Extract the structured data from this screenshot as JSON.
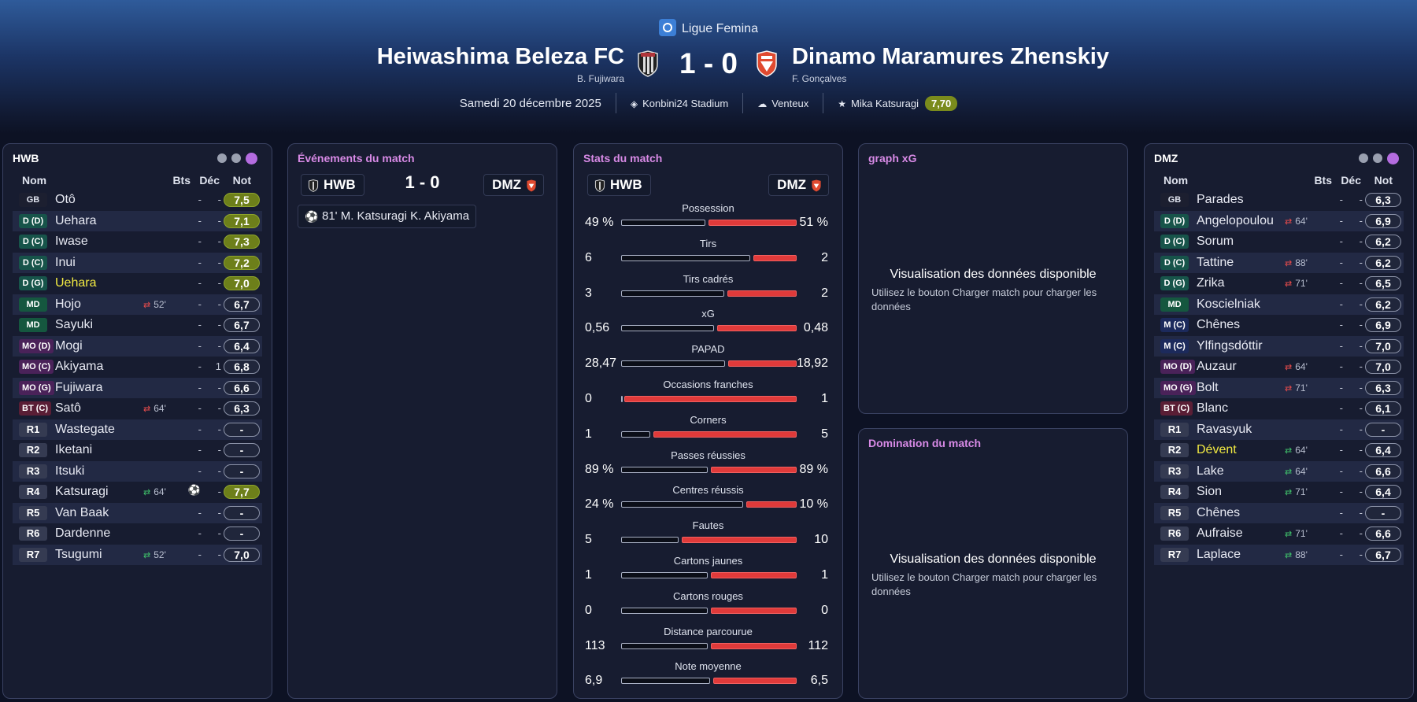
{
  "header": {
    "league": "Ligue Femina",
    "home": {
      "name": "Heiwashima Beleza FC",
      "coach": "B. Fujiwara"
    },
    "away": {
      "name": "Dinamo Maramures Zhenskiy",
      "coach": "F. Gonçalves"
    },
    "score": "1 - 0",
    "date": "Samedi 20 décembre 2025",
    "stadium": "Konbini24 Stadium",
    "weather": "Venteux",
    "motm_name": "Mika Katsuragi",
    "motm_rating": "7,70"
  },
  "lineup_headers": {
    "name": "Nom",
    "goals": "Bts",
    "dec": "Déc",
    "rating": "Not"
  },
  "home_lineup": {
    "title": "HWB",
    "players": [
      {
        "pos": "GB",
        "cls": "gk",
        "name": "Otô",
        "sub": "",
        "subdir": "",
        "bts": "-",
        "dec": "-",
        "rating": "7,5",
        "green": true
      },
      {
        "pos": "D (D)",
        "cls": "def",
        "name": "Uehara",
        "sub": "",
        "subdir": "",
        "bts": "-",
        "dec": "-",
        "rating": "7,1",
        "green": true
      },
      {
        "pos": "D (C)",
        "cls": "def",
        "name": "Iwase",
        "sub": "",
        "subdir": "",
        "bts": "-",
        "dec": "-",
        "rating": "7,3",
        "green": true
      },
      {
        "pos": "D (C)",
        "cls": "def",
        "name": "Inui",
        "sub": "",
        "subdir": "",
        "bts": "-",
        "dec": "-",
        "rating": "7,2",
        "green": true
      },
      {
        "pos": "D (G)",
        "cls": "def",
        "name": "Uehara",
        "hl": true,
        "sub": "",
        "subdir": "",
        "bts": "-",
        "dec": "-",
        "rating": "7,0",
        "green": true
      },
      {
        "pos": "MD",
        "cls": "mid",
        "name": "Hojo",
        "sub": "52'",
        "subdir": "out",
        "bts": "-",
        "dec": "-",
        "rating": "6,7"
      },
      {
        "pos": "MD",
        "cls": "mid",
        "name": "Sayuki",
        "sub": "",
        "subdir": "",
        "bts": "-",
        "dec": "-",
        "rating": "6,7"
      },
      {
        "pos": "MO (D)",
        "cls": "mo",
        "name": "Mogi",
        "sub": "",
        "subdir": "",
        "bts": "-",
        "dec": "-",
        "rating": "6,4"
      },
      {
        "pos": "MO (C)",
        "cls": "mo",
        "name": "Akiyama",
        "sub": "",
        "subdir": "",
        "bts": "-",
        "dec": "1",
        "rating": "6,8"
      },
      {
        "pos": "MO (G)",
        "cls": "mo",
        "name": "Fujiwara",
        "sub": "",
        "subdir": "",
        "bts": "-",
        "dec": "-",
        "rating": "6,6"
      },
      {
        "pos": "BT (C)",
        "cls": "bt",
        "name": "Satô",
        "sub": "64'",
        "subdir": "out",
        "bts": "-",
        "dec": "-",
        "rating": "6,3"
      },
      {
        "pos": "R1",
        "cls": "sub",
        "name": "Wastegate",
        "sub": "",
        "subdir": "",
        "bts": "-",
        "dec": "-",
        "rating": "-"
      },
      {
        "pos": "R2",
        "cls": "sub",
        "name": "Iketani",
        "sub": "",
        "subdir": "",
        "bts": "-",
        "dec": "-",
        "rating": "-"
      },
      {
        "pos": "R3",
        "cls": "sub",
        "name": "Itsuki",
        "sub": "",
        "subdir": "",
        "bts": "-",
        "dec": "-",
        "rating": "-"
      },
      {
        "pos": "R4",
        "cls": "sub",
        "name": "Katsuragi",
        "sub": "64'",
        "subdir": "in",
        "bts": "goal",
        "dec": "-",
        "rating": "7,7",
        "green": true
      },
      {
        "pos": "R5",
        "cls": "sub",
        "name": "Van Baak",
        "sub": "",
        "subdir": "",
        "bts": "-",
        "dec": "-",
        "rating": "-"
      },
      {
        "pos": "R6",
        "cls": "sub",
        "name": "Dardenne",
        "sub": "",
        "subdir": "",
        "bts": "-",
        "dec": "-",
        "rating": "-"
      },
      {
        "pos": "R7",
        "cls": "sub",
        "name": "Tsugumi",
        "sub": "52'",
        "subdir": "in",
        "bts": "-",
        "dec": "-",
        "rating": "7,0"
      }
    ]
  },
  "away_lineup": {
    "title": "DMZ",
    "players": [
      {
        "pos": "GB",
        "cls": "gk",
        "name": "Parades",
        "sub": "",
        "subdir": "",
        "bts": "-",
        "dec": "-",
        "rating": "6,3"
      },
      {
        "pos": "D (D)",
        "cls": "def",
        "name": "Angelopoulou",
        "sub": "64'",
        "subdir": "out",
        "bts": "-",
        "dec": "-",
        "rating": "6,9"
      },
      {
        "pos": "D (C)",
        "cls": "def",
        "name": "Sorum",
        "sub": "",
        "subdir": "",
        "bts": "-",
        "dec": "-",
        "rating": "6,2"
      },
      {
        "pos": "D (C)",
        "cls": "def",
        "name": "Tattine",
        "sub": "88'",
        "subdir": "out",
        "bts": "-",
        "dec": "-",
        "rating": "6,2"
      },
      {
        "pos": "D (G)",
        "cls": "def",
        "name": "Zrika",
        "sub": "71'",
        "subdir": "out",
        "bts": "-",
        "dec": "-",
        "rating": "6,5"
      },
      {
        "pos": "MD",
        "cls": "mid",
        "name": "Koscielniak",
        "sub": "",
        "subdir": "",
        "bts": "-",
        "dec": "-",
        "rating": "6,2"
      },
      {
        "pos": "M (C)",
        "cls": "mc",
        "name": "Chênes",
        "sub": "",
        "subdir": "",
        "bts": "-",
        "dec": "-",
        "rating": "6,9"
      },
      {
        "pos": "M (C)",
        "cls": "mc",
        "name": "Ylfingsdóttir",
        "sub": "",
        "subdir": "",
        "bts": "-",
        "dec": "-",
        "rating": "7,0"
      },
      {
        "pos": "MO (D)",
        "cls": "mo",
        "name": "Auzaur",
        "sub": "64'",
        "subdir": "out",
        "bts": "-",
        "dec": "-",
        "rating": "7,0"
      },
      {
        "pos": "MO (G)",
        "cls": "mo",
        "name": "Bolt",
        "sub": "71'",
        "subdir": "out",
        "bts": "-",
        "dec": "-",
        "rating": "6,3"
      },
      {
        "pos": "BT (C)",
        "cls": "bt",
        "name": "Blanc",
        "sub": "",
        "subdir": "",
        "bts": "-",
        "dec": "-",
        "rating": "6,1"
      },
      {
        "pos": "R1",
        "cls": "sub",
        "name": "Ravasyuk",
        "sub": "",
        "subdir": "",
        "bts": "-",
        "dec": "-",
        "rating": "-"
      },
      {
        "pos": "R2",
        "cls": "sub",
        "name": "Dévent",
        "hl": true,
        "sub": "64'",
        "subdir": "in",
        "bts": "-",
        "dec": "-",
        "rating": "6,4"
      },
      {
        "pos": "R3",
        "cls": "sub",
        "name": "Lake",
        "sub": "64'",
        "subdir": "in",
        "bts": "-",
        "dec": "-",
        "rating": "6,6"
      },
      {
        "pos": "R4",
        "cls": "sub",
        "name": "Sion",
        "sub": "71'",
        "subdir": "in",
        "bts": "-",
        "dec": "-",
        "rating": "6,4"
      },
      {
        "pos": "R5",
        "cls": "sub",
        "name": "Chênes",
        "sub": "",
        "subdir": "",
        "bts": "-",
        "dec": "-",
        "rating": "-"
      },
      {
        "pos": "R6",
        "cls": "sub",
        "name": "Aufraise",
        "sub": "71'",
        "subdir": "in",
        "bts": "-",
        "dec": "-",
        "rating": "6,6"
      },
      {
        "pos": "R7",
        "cls": "sub",
        "name": "Laplace",
        "sub": "88'",
        "subdir": "in",
        "bts": "-",
        "dec": "-",
        "rating": "6,7"
      }
    ]
  },
  "events": {
    "title": "Événements du match",
    "home_short": "HWB",
    "away_short": "DMZ",
    "score": "1 - 0",
    "items": [
      {
        "text": "81' M. Katsuragi K. Akiyama"
      }
    ]
  },
  "stats": {
    "title": "Stats du match",
    "home_short": "HWB",
    "away_short": "DMZ",
    "rows": [
      {
        "label": "Possession",
        "home": "49 %",
        "away": "51 %",
        "hv": 49,
        "av": 51
      },
      {
        "label": "Tirs",
        "home": "6",
        "away": "2",
        "hv": 6,
        "av": 2
      },
      {
        "label": "Tirs cadrés",
        "home": "3",
        "away": "2",
        "hv": 3,
        "av": 2
      },
      {
        "label": "xG",
        "home": "0,56",
        "away": "0,48",
        "hv": 0.56,
        "av": 0.48
      },
      {
        "label": "PAPAD",
        "home": "28,47",
        "away": "18,92",
        "hv": 28.47,
        "av": 18.92
      },
      {
        "label": "Occasions franches",
        "home": "0",
        "away": "1",
        "hv": 0,
        "av": 1
      },
      {
        "label": "Corners",
        "home": "1",
        "away": "5",
        "hv": 1,
        "av": 5
      },
      {
        "label": "Passes réussies",
        "home": "89 %",
        "away": "89 %",
        "hv": 89,
        "av": 89
      },
      {
        "label": "Centres réussis",
        "home": "24 %",
        "away": "10 %",
        "hv": 24,
        "av": 10
      },
      {
        "label": "Fautes",
        "home": "5",
        "away": "10",
        "hv": 5,
        "av": 10
      },
      {
        "label": "Cartons jaunes",
        "home": "1",
        "away": "1",
        "hv": 1,
        "av": 1
      },
      {
        "label": "Cartons rouges",
        "home": "0",
        "away": "0",
        "hv": 0,
        "av": 0
      },
      {
        "label": "Distance parcourue",
        "home": "113",
        "away": "112",
        "hv": 113,
        "av": 112
      },
      {
        "label": "Note moyenne",
        "home": "6,9",
        "away": "6,5",
        "hv": 6.9,
        "av": 6.5
      }
    ]
  },
  "xg_panel": {
    "title": "graph xG",
    "msg": "Visualisation des données disponible",
    "hint": "Utilisez le bouton Charger match pour charger les données"
  },
  "dom_panel": {
    "title": "Domination du match",
    "msg": "Visualisation des données disponible",
    "hint": "Utilisez le bouton Charger match pour charger les données"
  },
  "colors": {
    "accent": "#b46ce0",
    "away_bar": "#e03a3a",
    "rating_green": "#6d7f1a",
    "highlight": "#f2ea42"
  }
}
